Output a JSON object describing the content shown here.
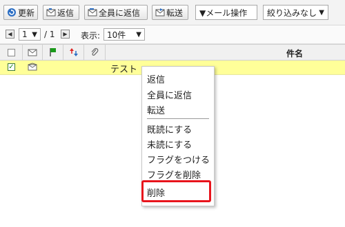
{
  "toolbar": {
    "refresh_label": "更新",
    "reply_label": "返信",
    "reply_all_label": "全員に返信",
    "forward_label": "転送",
    "mail_ops_label": "▼メール操作",
    "filter_label": "絞り込みなし",
    "filter_caret": "▼"
  },
  "pager": {
    "first_arrow": "◀",
    "page_value": "1",
    "page_caret": "▼",
    "page_total": "/ 1",
    "next_arrow": "▶",
    "display_label": "表示:",
    "per_page_value": "10件",
    "per_page_caret": "▼"
  },
  "table": {
    "subject_header": "件名",
    "rows": [
      {
        "subject": "テスト",
        "checked": true
      }
    ]
  },
  "context_menu": {
    "items": [
      "返信",
      "全員に返信",
      "転送",
      "既読にする",
      "未読にする",
      "フラグをつける",
      "フラグを削除",
      "削除"
    ]
  },
  "colors": {
    "selected_row": "#ffff99",
    "highlight": "#e8141c",
    "flag": "#1a9a1a"
  },
  "icons": [
    "refresh-icon",
    "reply-icon",
    "reply-all-icon",
    "forward-icon",
    "envelope-icon",
    "flag-icon",
    "priority-icon",
    "attachment-icon"
  ]
}
